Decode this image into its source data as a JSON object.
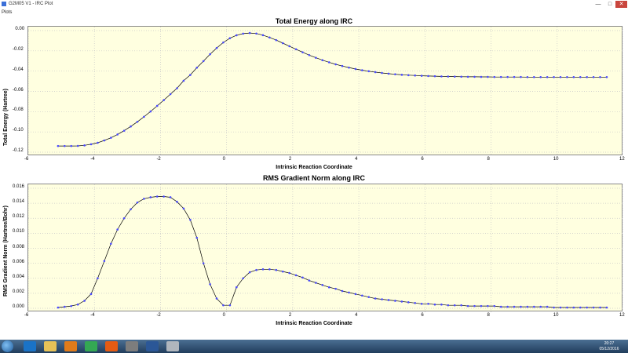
{
  "window": {
    "title": "G2M05 V1 - IRC Plot",
    "min_icon": "minimize-icon",
    "max_icon": "maximize-icon",
    "close_icon": "close-icon",
    "min": "—",
    "max": "□",
    "close": "✕"
  },
  "menu": {
    "plots_label": "Plots"
  },
  "chart_data": [
    {
      "type": "line",
      "title": "Total Energy along IRC",
      "xlabel": "Intrinsic Reaction Coordinate",
      "ylabel": "Total Energy (Hartree)",
      "xlim": [
        -6,
        12
      ],
      "ylim": [
        -0.12,
        0.0
      ],
      "xticks": [
        "-6",
        "-4",
        "-2",
        "0",
        "2",
        "4",
        "6",
        "8",
        "10",
        "12"
      ],
      "yticks": [
        "0.00",
        "-0.02",
        "-0.04",
        "-0.06",
        "-0.08",
        "-0.10",
        "-0.12"
      ],
      "grid": true,
      "series_color": "#4a4aff",
      "highlight_color": "#ff3333",
      "x": [
        -5.1,
        -4.9,
        -4.7,
        -4.5,
        -4.3,
        -4.1,
        -3.9,
        -3.7,
        -3.5,
        -3.3,
        -3.1,
        -2.9,
        -2.7,
        -2.5,
        -2.3,
        -2.1,
        -1.9,
        -1.7,
        -1.5,
        -1.3,
        -1.1,
        -0.9,
        -0.7,
        -0.5,
        -0.3,
        -0.1,
        0.1,
        0.3,
        0.5,
        0.7,
        0.9,
        1.1,
        1.3,
        1.5,
        1.7,
        1.9,
        2.1,
        2.3,
        2.5,
        2.7,
        2.9,
        3.1,
        3.3,
        3.5,
        3.7,
        3.9,
        4.1,
        4.3,
        4.5,
        4.7,
        4.9,
        5.1,
        5.3,
        5.5,
        5.7,
        5.9,
        6.1,
        6.3,
        6.5,
        6.7,
        6.9,
        7.1,
        7.3,
        7.5,
        7.7,
        7.9,
        8.1,
        8.3,
        8.5,
        8.7,
        8.9,
        9.1,
        9.3,
        9.5,
        9.7,
        9.9,
        10.1,
        10.3,
        10.5,
        10.7,
        10.9,
        11.1,
        11.3,
        11.5
      ],
      "y": [
        -0.1139,
        -0.1139,
        -0.1139,
        -0.1138,
        -0.1133,
        -0.1122,
        -0.1107,
        -0.1084,
        -0.1058,
        -0.1025,
        -0.0988,
        -0.0946,
        -0.09,
        -0.0851,
        -0.0798,
        -0.0743,
        -0.0686,
        -0.0627,
        -0.0569,
        -0.0495,
        -0.0438,
        -0.0366,
        -0.0301,
        -0.0233,
        -0.0172,
        -0.0117,
        -0.0075,
        -0.0046,
        -0.003,
        -0.0024,
        -0.0029,
        -0.0045,
        -0.0068,
        -0.0094,
        -0.0124,
        -0.0154,
        -0.0184,
        -0.0214,
        -0.0242,
        -0.0268,
        -0.0292,
        -0.0313,
        -0.0333,
        -0.035,
        -0.0365,
        -0.0379,
        -0.0391,
        -0.0401,
        -0.041,
        -0.0418,
        -0.0425,
        -0.0431,
        -0.0436,
        -0.044,
        -0.0443,
        -0.0446,
        -0.0448,
        -0.045,
        -0.0452,
        -0.0453,
        -0.0454,
        -0.0455,
        -0.0456,
        -0.0456,
        -0.0457,
        -0.0457,
        -0.0458,
        -0.0458,
        -0.0458,
        -0.0458,
        -0.0458,
        -0.0459,
        -0.0459,
        -0.0459,
        -0.0459,
        -0.0459,
        -0.0459,
        -0.0459,
        -0.0459,
        -0.0459,
        -0.0459,
        -0.0459,
        -0.0459,
        -0.0459
      ],
      "highlight_x": 8.8
    },
    {
      "type": "line",
      "title": "RMS Gradient Norm along IRC",
      "xlabel": "Intrinsic Reaction Coordinate",
      "ylabel": "RMS Gradient Norm (Hartree/Bohr)",
      "xlim": [
        -6,
        12
      ],
      "ylim": [
        0.0,
        0.016
      ],
      "xticks": [
        "-6",
        "-4",
        "-2",
        "0",
        "2",
        "4",
        "6",
        "8",
        "10",
        "12"
      ],
      "yticks": [
        "0.016",
        "0.014",
        "0.012",
        "0.010",
        "0.008",
        "0.006",
        "0.004",
        "0.002",
        "0.000"
      ],
      "grid": true,
      "series_color": "#4a4aff",
      "highlight_color": "#ff3333",
      "x": [
        -5.1,
        -4.9,
        -4.7,
        -4.5,
        -4.3,
        -4.1,
        -3.9,
        -3.7,
        -3.5,
        -3.3,
        -3.1,
        -2.9,
        -2.7,
        -2.5,
        -2.3,
        -2.1,
        -1.9,
        -1.7,
        -1.5,
        -1.3,
        -1.1,
        -0.9,
        -0.7,
        -0.5,
        -0.3,
        -0.1,
        0.1,
        0.3,
        0.5,
        0.7,
        0.9,
        1.1,
        1.3,
        1.5,
        1.7,
        1.9,
        2.1,
        2.3,
        2.5,
        2.7,
        2.9,
        3.1,
        3.3,
        3.5,
        3.7,
        3.9,
        4.1,
        4.3,
        4.5,
        4.7,
        4.9,
        5.1,
        5.3,
        5.5,
        5.7,
        5.9,
        6.1,
        6.3,
        6.5,
        6.7,
        6.9,
        7.1,
        7.3,
        7.5,
        7.7,
        7.9,
        8.1,
        8.3,
        8.5,
        8.7,
        8.9,
        9.1,
        9.3,
        9.5,
        9.7,
        9.9,
        10.1,
        10.3,
        10.5,
        10.7,
        10.9,
        11.1,
        11.3,
        11.5
      ],
      "y": [
        0.0001,
        0.0002,
        0.0003,
        0.0005,
        0.001,
        0.0019,
        0.004,
        0.0063,
        0.0086,
        0.0105,
        0.012,
        0.0132,
        0.0141,
        0.0146,
        0.0148,
        0.0149,
        0.0149,
        0.0148,
        0.0142,
        0.0133,
        0.0118,
        0.0094,
        0.006,
        0.0032,
        0.0013,
        0.0004,
        0.0004,
        0.0028,
        0.004,
        0.0048,
        0.0051,
        0.0052,
        0.0052,
        0.0051,
        0.0049,
        0.0047,
        0.0044,
        0.0041,
        0.0037,
        0.0034,
        0.0031,
        0.0028,
        0.0026,
        0.0023,
        0.0021,
        0.0019,
        0.0017,
        0.0015,
        0.0013,
        0.0012,
        0.0011,
        0.001,
        0.0009,
        0.0008,
        0.0007,
        0.0006,
        0.0006,
        0.0005,
        0.0005,
        0.0004,
        0.0004,
        0.0004,
        0.0003,
        0.0003,
        0.0003,
        0.0003,
        0.0003,
        0.0002,
        0.0002,
        0.0002,
        0.0002,
        0.0002,
        0.0002,
        0.0002,
        0.0002,
        0.0001,
        0.0001,
        0.0001,
        0.0001,
        0.0001,
        0.0001,
        0.0001,
        0.0001,
        0.0001
      ],
      "highlight_x": 8.8
    }
  ],
  "taskbar": {
    "start_icon": "windows-start-icon",
    "icons": [
      "internet-explorer-icon",
      "file-explorer-icon",
      "media-player-icon",
      "chrome-icon",
      "firefox-icon",
      "gaussview-icon",
      "word-icon",
      "paint-icon"
    ],
    "colors": [
      "#1a73c7",
      "#e7c257",
      "#e07b1a",
      "#34a853",
      "#e55b13",
      "#7d7d7d",
      "#2b5797",
      "#b0b6bd"
    ],
    "time": "20:27",
    "date": "05/12/2016"
  }
}
